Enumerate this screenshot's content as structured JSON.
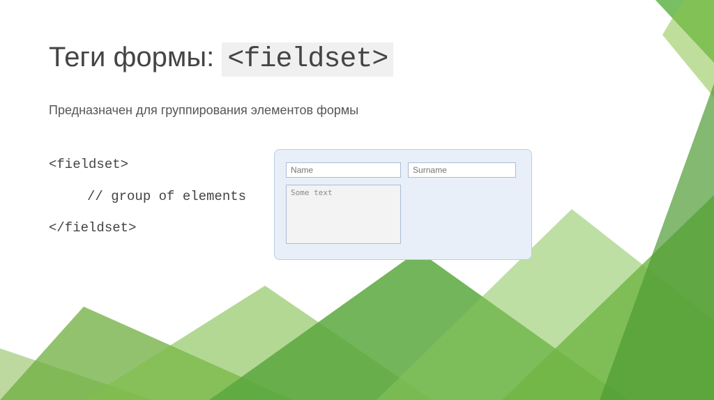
{
  "title": {
    "prefix": "Теги формы: ",
    "tag": "<fieldset>"
  },
  "description": "Предназначен для группирования элементов формы",
  "code": {
    "open": "<fieldset>",
    "body": "// group of elements",
    "close": "</fieldset>"
  },
  "demo": {
    "name_placeholder": "Name",
    "surname_placeholder": "Surname",
    "textarea_value": "Some text"
  }
}
